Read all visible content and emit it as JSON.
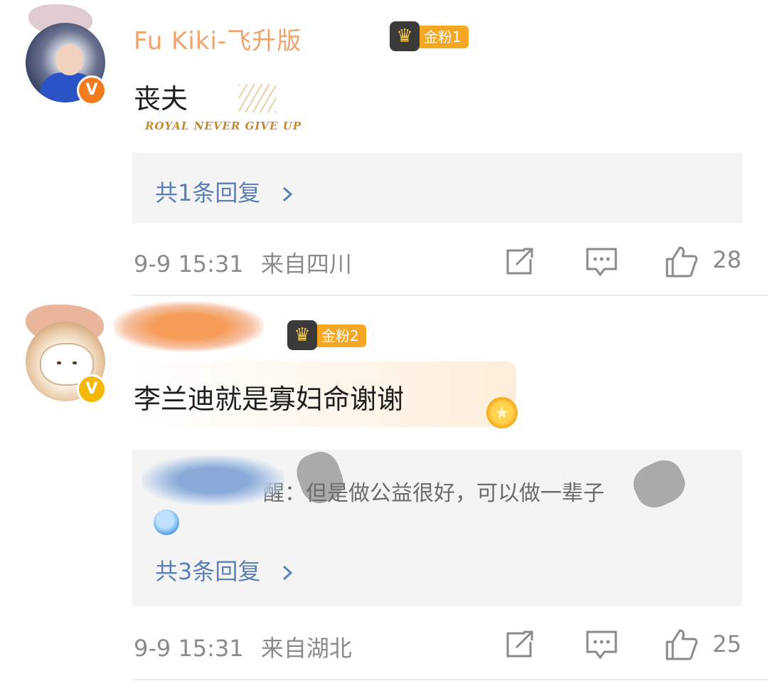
{
  "comments": [
    {
      "username": "Fu    Kiki-飞升版",
      "fan_badge": "金粉1",
      "text": "丧夫",
      "card_text": "ROYAL NEVER GIVE UP",
      "reply_link": "共1条回复",
      "date": "9-9 15:31",
      "location": "来自四川",
      "likes": "28"
    },
    {
      "fan_badge": "金粉2",
      "text": "李兰迪就是寡妇命谢谢",
      "reply_preview": "醒：但是做公益很好，可以做一辈子",
      "reply_link": "共3条回复",
      "date": "9-9 15:31",
      "location": "来自湖北",
      "likes": "25"
    }
  ],
  "icons": [
    "share-icon",
    "comment-icon",
    "like-icon",
    "verified-icon",
    "crown-icon",
    "chevron-right-icon"
  ],
  "colors": {
    "link": "#5b7fb7",
    "meta": "#8a8a8a",
    "fan_badge": "#f5a623",
    "verified_orange": "#f47a1f",
    "verified_yellow": "#f6b700"
  }
}
